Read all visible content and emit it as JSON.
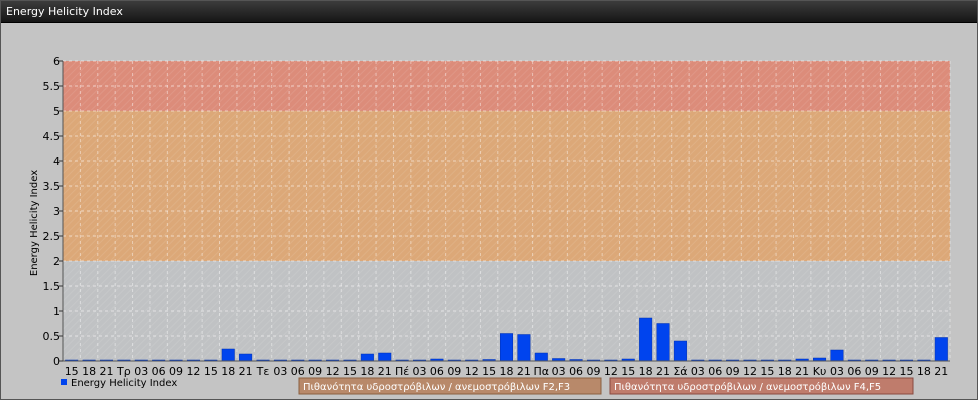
{
  "window": {
    "title": "Energy Helicity Index"
  },
  "chart_data": {
    "type": "bar",
    "ylabel": "Energy Helicity Index",
    "ylim": [
      0,
      6
    ],
    "y_ticks": [
      "0",
      "0.5",
      "1",
      "1.5",
      "2",
      "2.5",
      "3",
      "3.5",
      "4",
      "4.5",
      "5",
      "5.5",
      "6"
    ],
    "categories": [
      "15",
      "18",
      "21",
      "Τρ",
      "03",
      "06",
      "09",
      "12",
      "15",
      "18",
      "21",
      "Τε",
      "03",
      "06",
      "09",
      "12",
      "15",
      "18",
      "21",
      "Πέ",
      "03",
      "06",
      "09",
      "12",
      "15",
      "18",
      "21",
      "Πα",
      "03",
      "06",
      "09",
      "12",
      "15",
      "18",
      "21",
      "Σά",
      "03",
      "06",
      "09",
      "12",
      "15",
      "18",
      "21",
      "Κυ",
      "03",
      "06",
      "09",
      "12",
      "15",
      "18",
      "21"
    ],
    "series": [
      {
        "name": "Energy Helicity Index",
        "color": "#0044ee",
        "values": [
          0.01,
          0.01,
          0.02,
          0.01,
          0.01,
          0.02,
          0.01,
          0.01,
          0.02,
          0.24,
          0.14,
          0.02,
          0.01,
          0.01,
          0.02,
          0.02,
          0.01,
          0.14,
          0.16,
          0.01,
          0.02,
          0.04,
          0.02,
          0.02,
          0.03,
          0.55,
          0.53,
          0.16,
          0.05,
          0.03,
          0.02,
          0.02,
          0.04,
          0.86,
          0.75,
          0.4,
          0.02,
          0.02,
          0.01,
          0.02,
          0.01,
          0.01,
          0.04,
          0.06,
          0.22,
          0.01,
          0.01,
          0.01,
          0.01,
          0.02,
          0.47
        ]
      }
    ],
    "bands": [
      {
        "from": 0,
        "to": 2,
        "color": "#c0c2c4"
      },
      {
        "from": 2,
        "to": 5,
        "color": "#dca878",
        "label": "Πιθανότητα υδροστρόβιλων / ανεμοστρόβιλων F2,F3"
      },
      {
        "from": 5,
        "to": 6,
        "color": "#dc8c7a",
        "label": "Πιθανότητα υδροστρόβιλων / ανεμοστρόβιλων F4,F5"
      }
    ],
    "grid": true,
    "legend_position": "bottom-left"
  }
}
